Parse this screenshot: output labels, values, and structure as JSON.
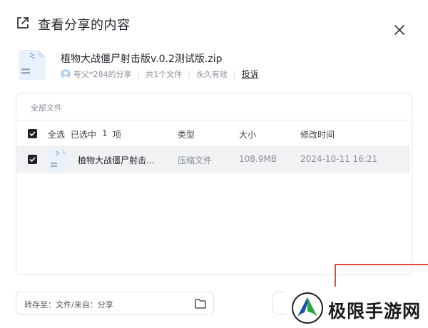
{
  "dialog": {
    "title": "查看分享的内容",
    "close_icon": "close-icon",
    "share_icon": "external-share-icon"
  },
  "file": {
    "name": "植物大战僵尸射击版v.0.2测试版.zip",
    "sharer": "夸父*284的分享",
    "count": "共1个文件",
    "validity": "永久有效",
    "report": "投诉",
    "icon": "zip-file-icon"
  },
  "panel": {
    "breadcrumb": "全部文件",
    "header": {
      "select_all": "全选",
      "selected": "已选中",
      "selected_count": "1",
      "selected_unit": "项",
      "col_type": "类型",
      "col_size": "大小",
      "col_time": "修改时间"
    },
    "rows": [
      {
        "name": "植物大战僵尸射击...",
        "type": "压缩文件",
        "size": "108.9MB",
        "time": "2024-10-11 16:21",
        "checked": true
      }
    ]
  },
  "footer": {
    "save_label": "转存至：文件/来自：分享",
    "folder_icon": "folder-icon"
  },
  "watermark": {
    "text": "极限手游网",
    "logo": "watermark-logo"
  },
  "colors": {
    "accent_dark": "#1f2329",
    "muted": "#8a8f99",
    "highlight_box": "#e54a3d",
    "row_bg": "#f1f2f4"
  }
}
